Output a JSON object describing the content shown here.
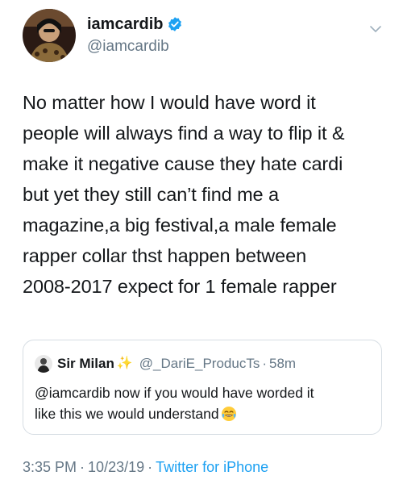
{
  "author": {
    "display_name": "iamcardib",
    "handle": "@iamcardib",
    "verified": true,
    "avatar_icon": "user-avatar"
  },
  "tweet": {
    "text": "No matter how I would have word it\npeople will always find a way to flip it &\nmake it negative cause they hate cardi\nbut yet they still can’t find me a\nmagazine,a big festival,a male female\nrapper collar thst happen between\n2008-2017 expect for 1 female rapper"
  },
  "quoted_tweet": {
    "display_name": "Sir Milan",
    "name_emoji": "✨",
    "handle": "@_DariE_ProducTs",
    "separator": "·",
    "time": "58m",
    "text": "@iamcardib now if you would have worded it\nlike this we would understand",
    "trailing_emoji": "face-with-tears-of-joy"
  },
  "meta": {
    "time": "3:35 PM",
    "date": "10/23/19",
    "separator": "·",
    "source": "Twitter for iPhone"
  },
  "colors": {
    "text": "#14171a",
    "secondary": "#657786",
    "link": "#1da1f2",
    "border": "#d6dde3"
  }
}
